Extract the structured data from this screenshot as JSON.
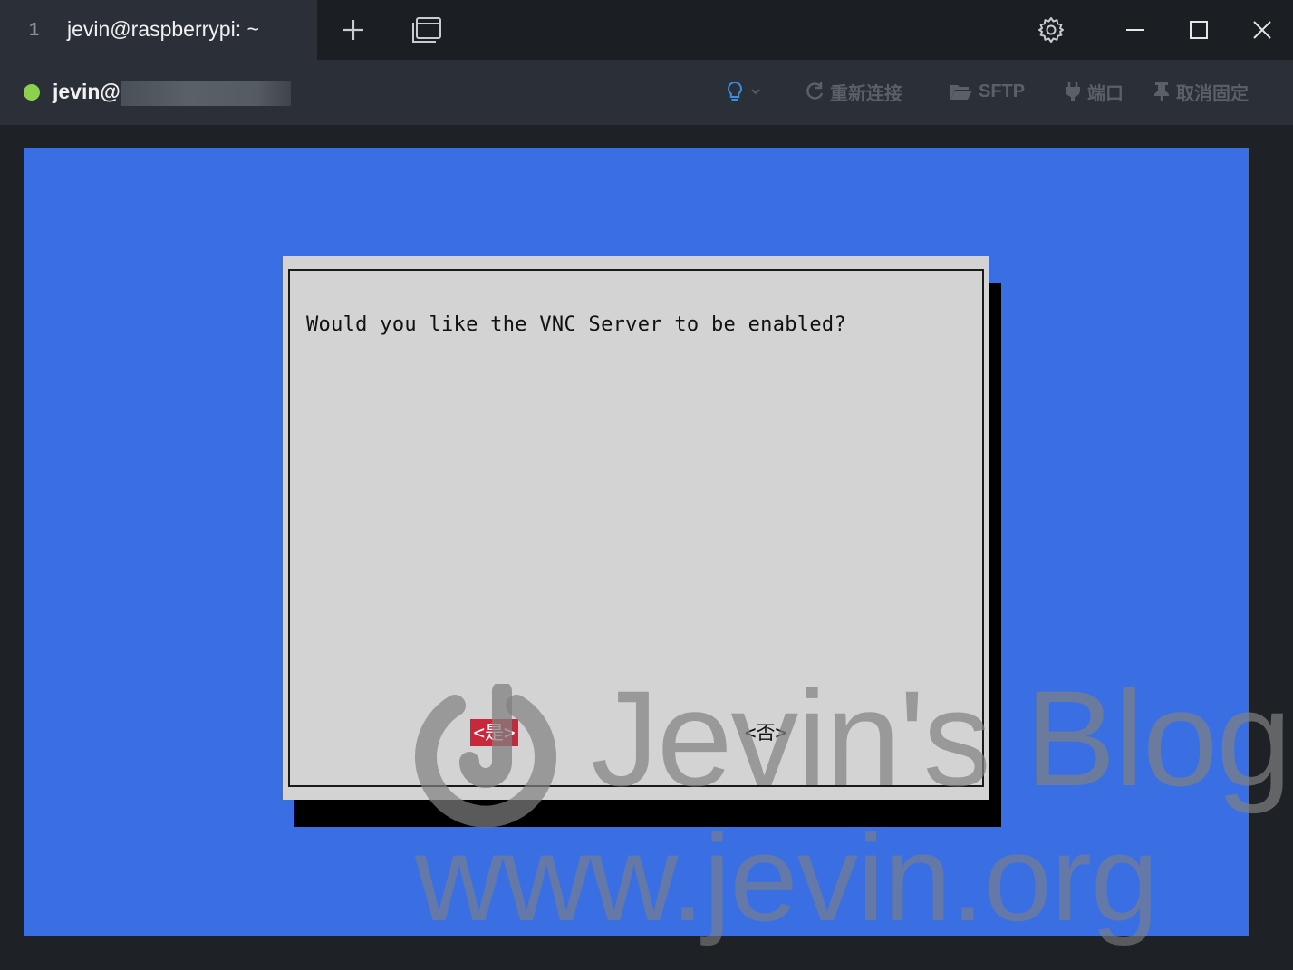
{
  "tab": {
    "index": "1",
    "title": "jevin@raspberrypi: ~"
  },
  "titlebar": {
    "new_tab_icon": "plus-icon",
    "overview_icon": "window-stack-icon",
    "settings_icon": "gear-icon",
    "minimize_icon": "minimize-icon",
    "maximize_icon": "maximize-icon",
    "close_icon": "close-icon"
  },
  "session": {
    "status_color": "#8bd14e",
    "host": "jevin@",
    "tools": {
      "hint_icon": "lightbulb-icon",
      "reconnect": "重新连接",
      "sftp": "SFTP",
      "port": "端口",
      "unpin": "取消固定"
    }
  },
  "terminal": {
    "background": "#3a6fe3",
    "dialog": {
      "message": "Would you like the VNC Server to be enabled?",
      "yes_label": "<是>",
      "no_label": "<否>"
    }
  },
  "watermark": {
    "title": "Jevin's Blog",
    "url": "www.jevin.org"
  }
}
